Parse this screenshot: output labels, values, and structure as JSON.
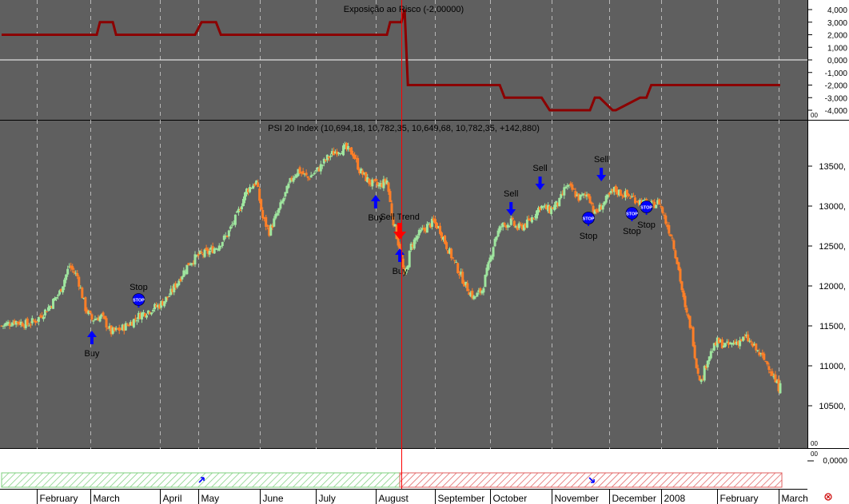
{
  "colors": {
    "panel_bg": "#5f5f5f",
    "axis_bg": "#ffffff",
    "exposure_line": "#8b0000",
    "candle_up": "#9fe69f",
    "candle_down": "#ff7f27",
    "signal_arrow": "#0000ff",
    "sell_trend_arrow": "#ff0000",
    "stop_marker": "#0000ff",
    "cursor_line": "#ff0000",
    "long_band": "#7fd07f",
    "short_band": "#e06060"
  },
  "chart_data": [
    {
      "type": "line",
      "title": "Exposição ao Risco (-2,00000)",
      "ylim": [
        -4,
        4
      ],
      "y_ticks": [
        "4,000",
        "3,000",
        "2,000",
        "1,000",
        "0,000",
        "-1,000",
        "-2,000",
        "-3,000",
        "-4,000"
      ],
      "y_tick_values": [
        4,
        3,
        2,
        1,
        0,
        -1,
        -2,
        -3,
        -4
      ],
      "corner_label": "00",
      "reference_line": 0,
      "series": [
        {
          "x": [
            0,
            59,
            61,
            69,
            71,
            120,
            124,
            133,
            136,
            239,
            241,
            248,
            250,
            252,
            309,
            312,
            335,
            340,
            365,
            368,
            371,
            379,
            381,
            396,
            400,
            403,
            483
          ],
          "values": [
            2,
            2,
            3,
            3,
            2,
            2,
            3,
            3,
            2,
            2,
            3,
            3,
            4,
            -2,
            -2,
            -3,
            -3,
            -4,
            -4,
            -3,
            -3,
            -4,
            -4,
            -3,
            -3,
            -2,
            -2
          ]
        }
      ]
    },
    {
      "type": "candlestick",
      "title": "PSI 20 Index (10,694,18, 10,782,35, 10,649,68, 10,782,35, +142,880)",
      "ylim": [
        10200,
        13900
      ],
      "y_ticks": [
        "13500,",
        "13000,",
        "12500,",
        "12000,",
        "11500,",
        "11000,",
        "10500,"
      ],
      "y_tick_values": [
        13500,
        13000,
        12500,
        12000,
        11500,
        11000,
        10500
      ],
      "corner_label": "00",
      "x_ticks": [
        "February",
        "March",
        "April",
        "May",
        "June",
        "July",
        "August",
        "September",
        "October",
        "November",
        "December",
        "2008",
        "February",
        "March"
      ],
      "x_tick_positions": [
        22,
        55,
        98,
        122,
        160,
        195,
        232,
        269,
        303,
        341,
        377,
        409,
        444,
        482
      ],
      "trend_points": [
        [
          0,
          11500
        ],
        [
          8,
          11560
        ],
        [
          16,
          11520
        ],
        [
          22,
          11580
        ],
        [
          30,
          11750
        ],
        [
          36,
          11920
        ],
        [
          42,
          12250
        ],
        [
          47,
          12120
        ],
        [
          52,
          11720
        ],
        [
          56,
          11580
        ],
        [
          62,
          11620
        ],
        [
          68,
          11420
        ],
        [
          74,
          11460
        ],
        [
          80,
          11540
        ],
        [
          86,
          11640
        ],
        [
          92,
          11700
        ],
        [
          98,
          11760
        ],
        [
          104,
          11880
        ],
        [
          110,
          12080
        ],
        [
          116,
          12280
        ],
        [
          122,
          12380
        ],
        [
          128,
          12420
        ],
        [
          134,
          12500
        ],
        [
          140,
          12640
        ],
        [
          146,
          12880
        ],
        [
          152,
          13200
        ],
        [
          158,
          13300
        ],
        [
          162,
          12850
        ],
        [
          166,
          12680
        ],
        [
          172,
          12950
        ],
        [
          176,
          13150
        ],
        [
          180,
          13350
        ],
        [
          184,
          13450
        ],
        [
          190,
          13350
        ],
        [
          196,
          13450
        ],
        [
          202,
          13600
        ],
        [
          208,
          13700
        ],
        [
          213,
          13720
        ],
        [
          218,
          13660
        ],
        [
          222,
          13450
        ],
        [
          228,
          13300
        ],
        [
          234,
          13250
        ],
        [
          239,
          13320
        ],
        [
          242,
          12900
        ],
        [
          247,
          12450
        ],
        [
          250,
          12100
        ],
        [
          254,
          12500
        ],
        [
          258,
          12630
        ],
        [
          264,
          12750
        ],
        [
          268,
          12800
        ],
        [
          272,
          12700
        ],
        [
          276,
          12500
        ],
        [
          282,
          12250
        ],
        [
          288,
          12000
        ],
        [
          293,
          11850
        ],
        [
          298,
          11950
        ],
        [
          302,
          12250
        ],
        [
          306,
          12600
        ],
        [
          310,
          12750
        ],
        [
          316,
          12800
        ],
        [
          320,
          12720
        ],
        [
          326,
          12780
        ],
        [
          330,
          12880
        ],
        [
          334,
          13000
        ],
        [
          340,
          12950
        ],
        [
          346,
          13050
        ],
        [
          350,
          13250
        ],
        [
          354,
          13200
        ],
        [
          358,
          13100
        ],
        [
          364,
          13150
        ],
        [
          368,
          12900
        ],
        [
          374,
          13050
        ],
        [
          380,
          13200
        ],
        [
          386,
          13150
        ],
        [
          392,
          13100
        ],
        [
          397,
          13050
        ],
        [
          402,
          13000
        ],
        [
          408,
          13050
        ],
        [
          412,
          12800
        ],
        [
          416,
          12600
        ],
        [
          420,
          12200
        ],
        [
          424,
          11700
        ],
        [
          428,
          11450
        ],
        [
          431,
          11000
        ],
        [
          434,
          10800
        ],
        [
          438,
          11100
        ],
        [
          444,
          11300
        ],
        [
          450,
          11250
        ],
        [
          456,
          11300
        ],
        [
          462,
          11350
        ],
        [
          468,
          11200
        ],
        [
          472,
          11100
        ],
        [
          476,
          11000
        ],
        [
          480,
          10800
        ],
        [
          483,
          10700
        ]
      ],
      "last_close": 10782.35,
      "annotations": [
        {
          "label": "Buy",
          "type": "buy",
          "x": 56,
          "y": 11420
        },
        {
          "label": "Stop",
          "type": "stop",
          "x": 85,
          "y": 11830
        },
        {
          "label": "Buy",
          "type": "buy",
          "x": 232,
          "y": 13120
        },
        {
          "label": "Sell Trend",
          "type": "sell_trend",
          "x": 247,
          "y": 12580
        },
        {
          "label": "Buy",
          "type": "buy",
          "x": 247,
          "y": 12450
        },
        {
          "label": "Sell",
          "type": "sell",
          "x": 316,
          "y": 12900
        },
        {
          "label": "Sell",
          "type": "sell",
          "x": 334,
          "y": 13220
        },
        {
          "label": "Stop",
          "type": "stop",
          "x": 364,
          "y": 12850
        },
        {
          "label": "Sell",
          "type": "sell",
          "x": 372,
          "y": 13330
        },
        {
          "label": "Stop",
          "type": "stop",
          "x": 391,
          "y": 12910
        },
        {
          "label": "Stop",
          "type": "stop",
          "x": 400,
          "y": 12990
        }
      ]
    },
    {
      "type": "area",
      "title": "",
      "values": [
        0
      ],
      "y_tick": "0,0000",
      "corner_label": "00"
    },
    {
      "type": "area",
      "title": "",
      "segments": [
        {
          "state": "long",
          "x_start": 0,
          "x_end": 247
        },
        {
          "state": "short",
          "x_start": 247,
          "x_end": 484
        }
      ],
      "markers": [
        {
          "x": 124,
          "direction": "up"
        },
        {
          "x": 366,
          "direction": "down"
        }
      ]
    }
  ],
  "icons": {
    "status": "circle-x-icon"
  }
}
